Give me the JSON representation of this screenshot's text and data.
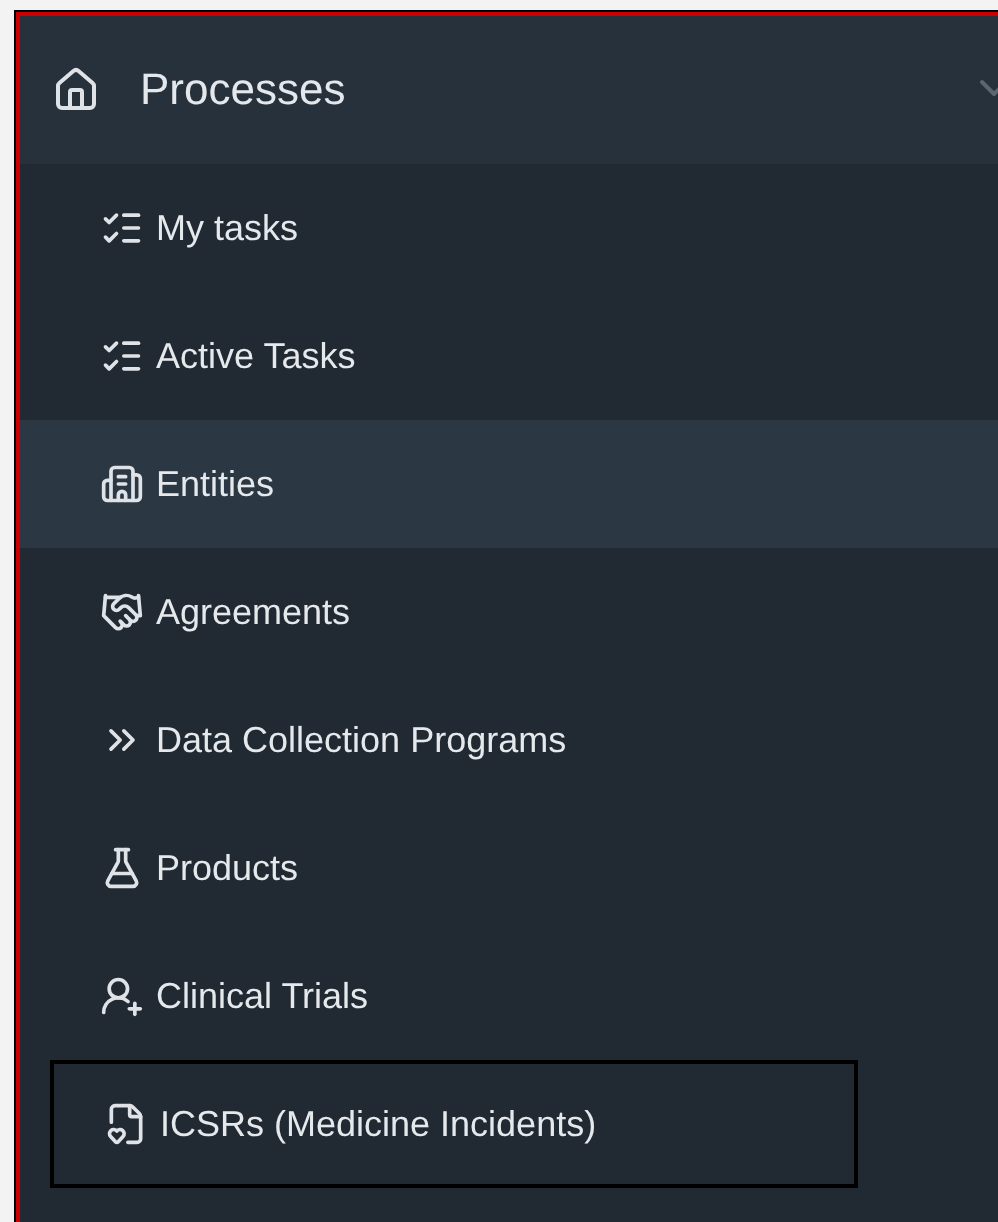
{
  "header": {
    "title": "Processes",
    "expanded": true
  },
  "items": [
    {
      "label": "My tasks",
      "selected": false,
      "focused": false
    },
    {
      "label": "Active Tasks",
      "selected": false,
      "focused": false
    },
    {
      "label": "Entities",
      "selected": true,
      "focused": false
    },
    {
      "label": "Agreements",
      "selected": false,
      "focused": false
    },
    {
      "label": "Data Collection Programs",
      "selected": false,
      "focused": false
    },
    {
      "label": "Products",
      "selected": false,
      "focused": false
    },
    {
      "label": "Clinical Trials",
      "selected": false,
      "focused": false
    },
    {
      "label": "ICSRs (Medicine Incidents)",
      "selected": false,
      "focused": true
    }
  ]
}
